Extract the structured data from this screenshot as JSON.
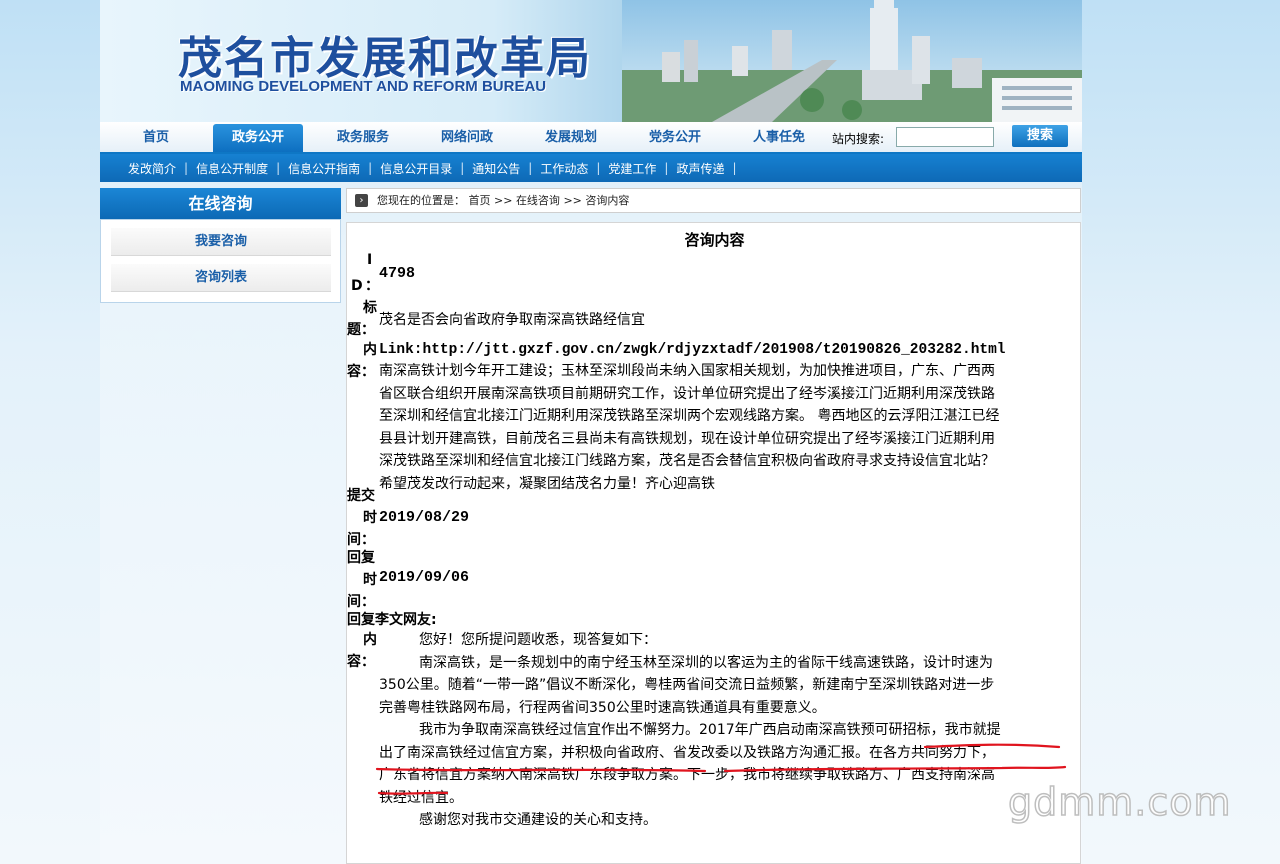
{
  "site": {
    "title_cn": "茂名市发展和改革局",
    "title_en": "MAOMING DEVELOPMENT AND REFORM  BUREAU"
  },
  "nav": {
    "items": [
      "首页",
      "政务公开",
      "政务服务",
      "网络问政",
      "发展规划",
      "党务公开",
      "人事任免"
    ],
    "active_index": 1,
    "search_label": "站内搜索:",
    "search_value": "",
    "search_button": "搜索"
  },
  "subnav": {
    "items": [
      "发改简介",
      "信息公开制度",
      "信息公开指南",
      "信息公开目录",
      "通知公告",
      "工作动态",
      "党建工作",
      "政声传递"
    ],
    "separator": "|"
  },
  "sidebar": {
    "title": "在线咨询",
    "items": [
      "我要咨询",
      "咨询列表"
    ]
  },
  "breadcrumb": {
    "prefix": "您现在的位置是：",
    "links": [
      "首页",
      "在线咨询",
      "咨询内容"
    ],
    "separator": ">>"
  },
  "consult": {
    "heading": "咨询内容",
    "id_label": [
      "I",
      "D",
      "："
    ],
    "id_value": "4798",
    "title_label": [
      "标",
      "题："
    ],
    "title_value": "茂名是否会向省政府争取南深高铁路经信宜",
    "content_label": [
      "内",
      "容："
    ],
    "link_line": "Link:http://jtt.gxzf.gov.cn/zwgk/rdjyzxtadf/201908/t20190826_203282.html",
    "content_lines": [
      "南深高铁计划今年开工建设；玉林至深圳段尚未纳入国家相关规划，为加快推进项目，广东、广西两",
      "省区联合组织开展南深高铁项目前期研究工作，设计单位研究提出了经岑溪接江门近期利用深茂铁路",
      "至深圳和经信宜北接江门近期利用深茂铁路至深圳两个宏观线路方案。 粤西地区的云浮阳江湛江已经",
      "县县计划开建高铁，目前茂名三县尚未有高铁规划，现在设计单位研究提出了经岑溪接江门近期利用",
      "深茂铁路至深圳和经信宜北接江门线路方案，茂名是否会替信宜积极向省政府寻求支持设信宜北站？",
      "希望茂发改行动起来，凝聚团结茂名力量！齐心迎高铁"
    ],
    "submit_label": [
      "提交",
      "时",
      "间："
    ],
    "submit_time": "2019/08/29",
    "reply_label": [
      "回复",
      "时",
      "间："
    ],
    "reply_time": "2019/09/06",
    "reply_to": "回复李文网友:",
    "reply_content_label": [
      "内",
      "容："
    ],
    "reply_lines": [
      "您好！您所提问题收悉，现答复如下：",
      "南深高铁，是一条规划中的南宁经玉林至深圳的以客运为主的省际干线高速铁路，设计时速为",
      "350公里。随着“一带一路”倡议不断深化，粤桂两省间交流日益频繁，新建南宁至深圳铁路对进一步",
      "完善粤桂铁路网布局，行程两省间350公里时速高铁通道具有重要意义。",
      "我市为争取南深高铁经过信宜作出不懈努力。2017年广西启动南深高铁预可研招标，我市就提",
      "出了南深高铁经过信宜方案，并积极向省政府、省发改委以及铁路方沟通汇报。在各方共同努力下，",
      "广东省将信宜方案纳入南深高铁广东段争取方案。下一步，我市将继续争取铁路方、广西支持南深高",
      "铁经过信宜。",
      "感谢您对我市交通建设的关心和支持。"
    ]
  },
  "watermark": "gdmm.com",
  "colors": {
    "primary_blue": "#0e6fbd",
    "annotation_red": "#e0141e"
  }
}
